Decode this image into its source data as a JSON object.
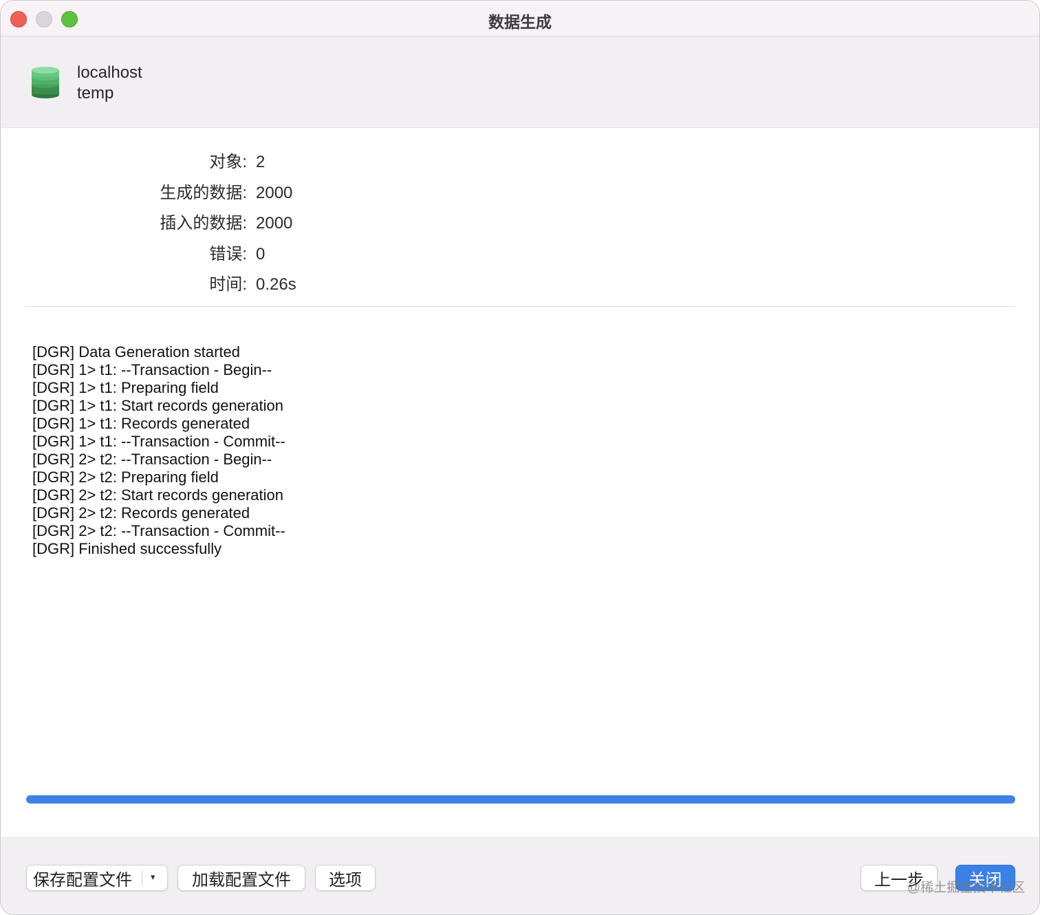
{
  "window": {
    "title": "数据生成"
  },
  "connection": {
    "name": "localhost",
    "database": "temp",
    "icon": "database-icon"
  },
  "stats": [
    {
      "label": "对象:",
      "value": "2"
    },
    {
      "label": "生成的数据:",
      "value": "2000"
    },
    {
      "label": "插入的数据:",
      "value": "2000"
    },
    {
      "label": "错误:",
      "value": "0"
    },
    {
      "label": "时间:",
      "value": "0.26s"
    }
  ],
  "log": [
    "[DGR] Data Generation started",
    "[DGR] 1> t1: --Transaction - Begin--",
    "[DGR] 1> t1: Preparing field",
    "[DGR] 1> t1: Start records generation",
    "[DGR] 1> t1: Records generated",
    "[DGR] 1> t1: --Transaction - Commit--",
    "[DGR] 2> t2: --Transaction - Begin--",
    "[DGR] 2> t2: Preparing field",
    "[DGR] 2> t2: Start records generation",
    "[DGR] 2> t2: Records generated",
    "[DGR] 2> t2: --Transaction - Commit--",
    "[DGR] Finished successfully"
  ],
  "progress": {
    "fraction": 1.0,
    "color": "#3f82e2"
  },
  "footer": {
    "save_config_label": "保存配置文件",
    "save_config_arrow": "▾",
    "load_config_label": "加载配置文件",
    "options_label": "选项",
    "back_label": "上一步",
    "close_label": "关闭"
  },
  "watermark": "@稀土掘金技术社区"
}
